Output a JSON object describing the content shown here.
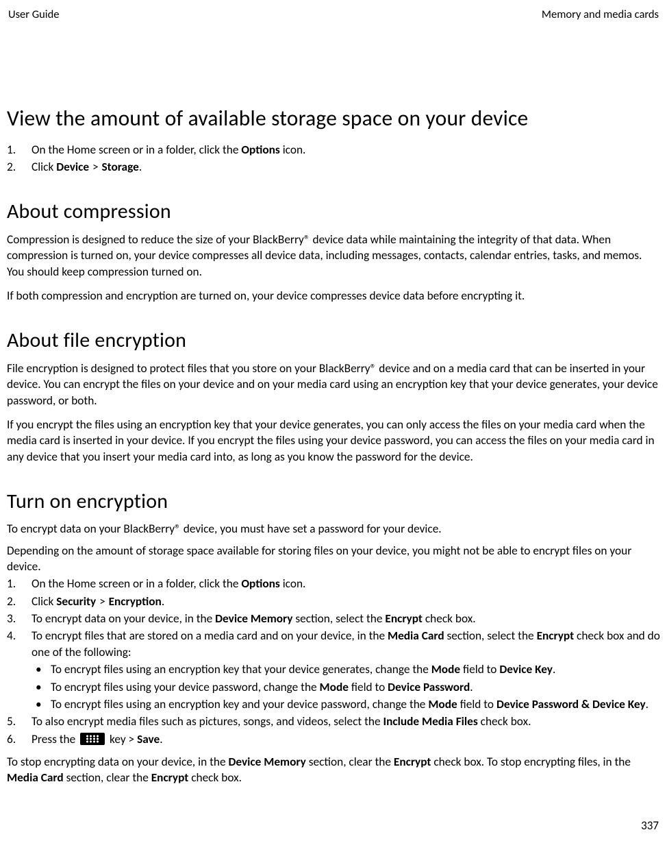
{
  "header": {
    "left": "User Guide",
    "right": "Memory and media cards"
  },
  "s1": {
    "title": "View the amount of available storage space on your device",
    "li1a": "On the Home screen or in a folder, click the ",
    "li1b": "Options",
    "li1c": " icon.",
    "li2a": "Click ",
    "li2b": "Device",
    "li2c": "Storage",
    "dot": "."
  },
  "s2": {
    "title": "About compression",
    "p1": "Compression is designed to reduce the size of your BlackBerry® device data while maintaining the integrity of that data. When compression is turned on, your device compresses all device data, including messages, contacts, calendar entries, tasks, and memos. You should keep compression turned on.",
    "p2": "If both compression and encryption are turned on, your device compresses device data before encrypting it."
  },
  "s3": {
    "title": "About file encryption",
    "p1": "File encryption is designed to protect files that you store on your BlackBerry® device and on a media card that can be inserted in your device. You can encrypt the files on your device and on your media card using an encryption key that your device generates, your device password, or both.",
    "p2": "If you encrypt the files using an encryption key that your device generates, you can only access the files on your media card when the media card is inserted in your device. If you encrypt the files using your device password, you can access the files on your media card in any device that you insert your media card into, as long as you know the password for the device."
  },
  "s4": {
    "title": "Turn on encryption",
    "p1": "To encrypt data on your BlackBerry® device, you must have set a password for your device.",
    "p2": "Depending on the amount of storage space available for storing files on your device, you might not be able to encrypt files on your device.",
    "li1a": "On the Home screen or in a folder, click the ",
    "li1b": "Options",
    "li1c": " icon.",
    "li2a": "Click ",
    "li2b": "Security",
    "li2c": "Encryption",
    "li3a": "To encrypt data on your device, in the ",
    "li3b": "Device Memory",
    "li3c": " section, select the ",
    "li3d": "Encrypt",
    "li3e": " check box.",
    "li4a": "To encrypt files that are stored on a media card and on your device, in the ",
    "li4b": "Media Card",
    "li4c": " section, select the ",
    "li4d": "Encrypt",
    "li4e": " check box and do one of the following:",
    "b1a": "To encrypt files using an encryption key that your device generates, change the ",
    "b1b": "Mode",
    "b1c": " field to ",
    "b1d": "Device Key",
    "b2a": "To encrypt files using your device password, change the ",
    "b2b": "Mode",
    "b2c": " field to ",
    "b2d": "Device Password",
    "b3a": "To encrypt files using an encryption key and your device password, change the ",
    "b3b": "Mode",
    "b3c": " field to ",
    "b3d": "Device Password & Device Key",
    "li5a": "To also encrypt media files such as pictures, songs, and videos, select the ",
    "li5b": "Include Media Files",
    "li5c": " check box.",
    "li6a": "Press the ",
    "li6b": " key > ",
    "li6c": "Save",
    "p3a": "To stop encrypting data on your device, in the ",
    "p3b": "Device Memory",
    "p3c": " section, clear the ",
    "p3d": "Encrypt",
    "p3e": " check box. To stop encrypting files, in the ",
    "p3f": "Media Card",
    "p3g": " section, clear the ",
    "p3h": "Encrypt",
    "p3i": " check box."
  },
  "gt": " > ",
  "dot": ".",
  "page_number": "337"
}
